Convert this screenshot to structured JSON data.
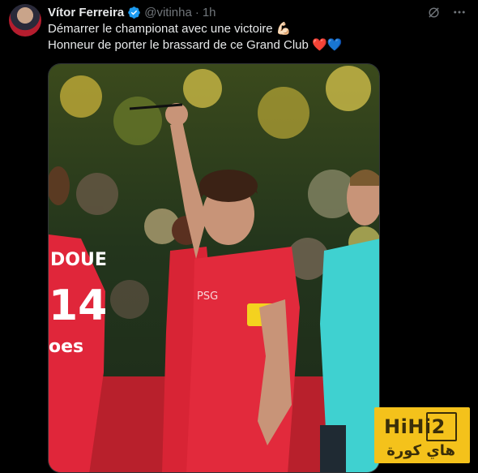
{
  "author": {
    "name": "Vítor Ferreira",
    "handle": "@vitinha",
    "separator": "·",
    "time": "1h"
  },
  "icons": {
    "verified": "verified-badge-icon",
    "grok": "grok-icon",
    "more": "more-options-icon"
  },
  "tweet": {
    "line1": "Démarrer le championat avec une victoire 💪🏻",
    "line2": "Honneur de porter le brassard de ce Grand Club ❤️💙"
  },
  "media": {
    "jersey_left_name": "DOUE",
    "jersey_left_number": "14",
    "sponsor_partial": "oes"
  },
  "watermark": {
    "latin": "HiHi2",
    "arabic": "هاي كورة"
  },
  "colors": {
    "verified_blue": "#1d9bf0",
    "psg_red": "#e0263a",
    "armband_yellow": "#f4d21f",
    "referee_cyan": "#3fd1d0",
    "watermark_yellow": "#f4c21b"
  }
}
